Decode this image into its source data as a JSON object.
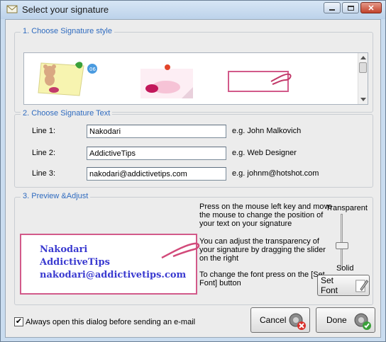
{
  "window": {
    "title": "Select your signature",
    "controls": {
      "minimize": "minimize-icon",
      "maximize": "maximize-icon",
      "close": "close-icon"
    }
  },
  "style_section": {
    "title": "1. Choose Signature style",
    "thumbnails": [
      {
        "name": "teddy-bear-sticky-note",
        "selected": false
      },
      {
        "name": "pink-lips-note",
        "selected": false
      },
      {
        "name": "paperclip-card",
        "selected": true
      }
    ]
  },
  "text_section": {
    "title": "2. Choose Signature Text",
    "lines": [
      {
        "label": "Line 1:",
        "value": "Nakodari",
        "example": "e.g. John Malkovich"
      },
      {
        "label": "Line 2:",
        "value": "AddictiveTips",
        "example": "e.g. Web Designer"
      },
      {
        "label": "Line 3:",
        "value": "nakodari@addictivetips.com",
        "example": "e.g. johnm@hotshot.com"
      }
    ]
  },
  "preview_section": {
    "title": "3. Preview &Adjust",
    "hint_move": [
      "Press on the mouse left key and move",
      "the mouse to change the position of",
      "your text on your signature"
    ],
    "hint_transparency": [
      "You can adjust the transparency of",
      "your signature by dragging the slider",
      "on the right"
    ],
    "hint_font": [
      "To change the font press on the [Set",
      "Font] button"
    ],
    "preview_lines": [
      "Nakodari",
      "AddictiveTips",
      "nakodari@addictivetips.com"
    ],
    "slider_top_label": "Transparent",
    "slider_bottom_label": "Solid",
    "transparency_level": 0.6,
    "set_font_label": "Set Font"
  },
  "footer": {
    "checkbox_label": "Always open this dialog before sending an e-mail",
    "checkbox_checked": true,
    "cancel_label": "Cancel",
    "done_label": "Done"
  },
  "colors": {
    "accent": "#2f6bbf",
    "preview_border": "#d25a8a",
    "preview_text": "#3a3ad0"
  }
}
